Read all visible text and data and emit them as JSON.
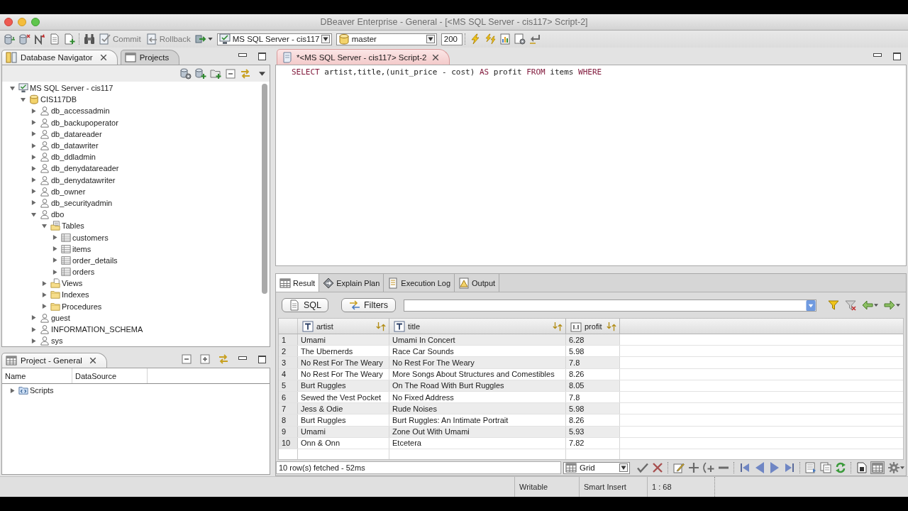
{
  "window": {
    "title": "DBeaver Enterprise - General - [<MS SQL Server - cis117> Script-2]"
  },
  "toolbar": {
    "commit": "Commit",
    "rollback": "Rollback",
    "connection": "MS SQL Server - cis117",
    "database": "master",
    "max_rows": "200"
  },
  "navigator": {
    "tabs": [
      {
        "label": "Database Navigator",
        "kind": "database",
        "selected": true
      },
      {
        "label": "Projects",
        "kind": "project",
        "selected": false
      }
    ],
    "tree": [
      {
        "label": "MS SQL Server - cis117",
        "kind": "connection",
        "expanded": true,
        "children": [
          {
            "label": "CIS117DB",
            "kind": "database",
            "expanded": true,
            "children": [
              {
                "label": "db_accessadmin",
                "kind": "schema",
                "expanded": false
              },
              {
                "label": "db_backupoperator",
                "kind": "schema",
                "expanded": false
              },
              {
                "label": "db_datareader",
                "kind": "schema",
                "expanded": false
              },
              {
                "label": "db_datawriter",
                "kind": "schema",
                "expanded": false
              },
              {
                "label": "db_ddladmin",
                "kind": "schema",
                "expanded": false
              },
              {
                "label": "db_denydatareader",
                "kind": "schema",
                "expanded": false
              },
              {
                "label": "db_denydatawriter",
                "kind": "schema",
                "expanded": false
              },
              {
                "label": "db_owner",
                "kind": "schema",
                "expanded": false
              },
              {
                "label": "db_securityadmin",
                "kind": "schema",
                "expanded": false
              },
              {
                "label": "dbo",
                "kind": "schema",
                "expanded": true,
                "children": [
                  {
                    "label": "Tables",
                    "kind": "tables",
                    "expanded": true,
                    "children": [
                      {
                        "label": "customers",
                        "kind": "table",
                        "expanded": false
                      },
                      {
                        "label": "items",
                        "kind": "table",
                        "expanded": false
                      },
                      {
                        "label": "order_details",
                        "kind": "table",
                        "expanded": false
                      },
                      {
                        "label": "orders",
                        "kind": "table",
                        "expanded": false
                      }
                    ]
                  },
                  {
                    "label": "Views",
                    "kind": "views",
                    "expanded": false
                  },
                  {
                    "label": "Indexes",
                    "kind": "folder",
                    "expanded": false
                  },
                  {
                    "label": "Procedures",
                    "kind": "folder",
                    "expanded": false
                  }
                ]
              },
              {
                "label": "guest",
                "kind": "schema",
                "expanded": false
              },
              {
                "label": "INFORMATION_SCHEMA",
                "kind": "schema",
                "expanded": false
              },
              {
                "label": "sys",
                "kind": "schema",
                "expanded": false
              }
            ]
          }
        ]
      }
    ]
  },
  "project": {
    "tab": {
      "label": "Project - General",
      "selected": true
    },
    "columns": [
      "Name",
      "DataSource"
    ],
    "rows": [
      {
        "label": "Scripts",
        "kind": "scripts",
        "expanded": false
      }
    ]
  },
  "editor": {
    "tab": {
      "label": "*<MS SQL Server - cis117> Script-2",
      "selected": true
    },
    "code": [
      {
        "text": "SELECT",
        "kind": "keyword"
      },
      {
        "text": " artist,title,(unit_price - cost) ",
        "kind": "plain"
      },
      {
        "text": "AS",
        "kind": "keyword"
      },
      {
        "text": " profit ",
        "kind": "plain"
      },
      {
        "text": "FROM",
        "kind": "keyword"
      },
      {
        "text": " items ",
        "kind": "plain"
      },
      {
        "text": "WHERE",
        "kind": "keyword"
      }
    ]
  },
  "results": {
    "tabs": [
      {
        "label": "Result",
        "kind": "grid",
        "selected": true
      },
      {
        "label": "Explain Plan",
        "kind": "plan",
        "selected": false
      },
      {
        "label": "Execution Log",
        "kind": "log",
        "selected": false
      },
      {
        "label": "Output",
        "kind": "output",
        "selected": false
      }
    ],
    "sql_button": "SQL",
    "filters_button": "Filters",
    "columns": [
      {
        "label": "artist",
        "kind": "text"
      },
      {
        "label": "title",
        "kind": "text"
      },
      {
        "label": "profit",
        "kind": "number"
      }
    ],
    "rows": [
      {
        "number": "1",
        "cells": [
          "Umami",
          "Umami In Concert",
          "6.28"
        ]
      },
      {
        "number": "2",
        "cells": [
          "The Ubernerds",
          "Race Car Sounds",
          "5.98"
        ]
      },
      {
        "number": "3",
        "cells": [
          "No Rest For The Weary",
          "No Rest For The Weary",
          "7.8"
        ]
      },
      {
        "number": "4",
        "cells": [
          "No Rest For The Weary",
          "More Songs About Structures and Comestibles",
          "8.26"
        ]
      },
      {
        "number": "5",
        "cells": [
          "Burt Ruggles",
          "On The Road With Burt Ruggles",
          "8.05"
        ]
      },
      {
        "number": "6",
        "cells": [
          "Sewed the Vest Pocket",
          "No Fixed Address",
          "7.8"
        ]
      },
      {
        "number": "7",
        "cells": [
          "Jess & Odie",
          "Rude Noises",
          "5.98"
        ]
      },
      {
        "number": "8",
        "cells": [
          "Burt Ruggles",
          "Burt Ruggles: An Intimate Portrait",
          "8.26"
        ]
      },
      {
        "number": "9",
        "cells": [
          "Umami",
          "Zone Out With Umami",
          "5.93"
        ]
      },
      {
        "number": "10",
        "cells": [
          "Onn & Onn",
          "Etcetera",
          "7.82"
        ]
      }
    ],
    "status": "10 row(s) fetched - 52ms",
    "view": "Grid",
    "grid_toggle_on": true
  },
  "status_bar": [
    "Writable",
    "Smart Insert",
    "1 : 68"
  ]
}
